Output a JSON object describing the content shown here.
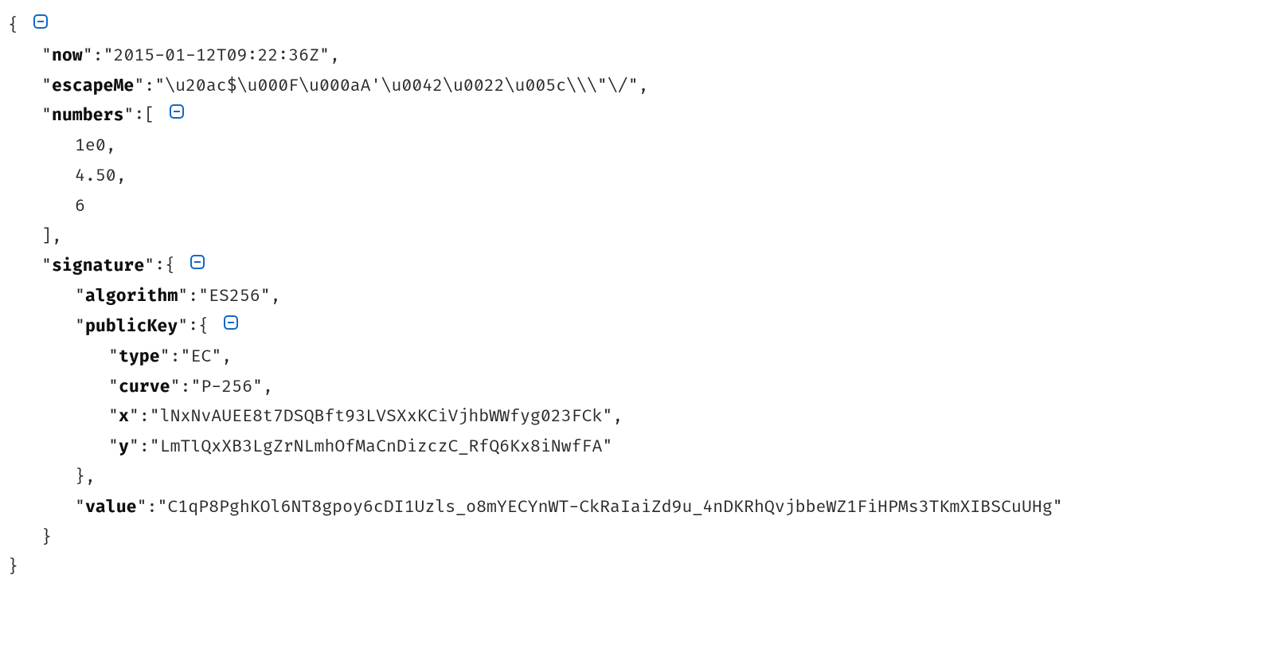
{
  "json": {
    "now": "2015-01-12T09:22:36Z",
    "escapeMe": "\\u20ac$\\u000F\\u000aA'\\u0042\\u0022\\u005c\\\\\\\"\\/",
    "numbers": [
      "1e0",
      "4.50",
      "6"
    ],
    "signature": {
      "algorithm": "ES256",
      "publicKey": {
        "type": "EC",
        "curve": "P-256",
        "x": "lNxNvAUEE8t7DSQBft93LVSXxKCiVjhbWWfyg023FCk",
        "y": "LmTlQxXB3LgZrNLmhOfMaCnDizczC_RfQ6Kx8iNwfFA"
      },
      "value": "C1qP8PghKOl6NT8gpoy6cDI1Uzls_o8mYECYnWT-CkRaIaiZd9u_4nDKRhQvjbbeWZ1FiHPMs3TKmXIBSCuUHg"
    }
  },
  "keys": {
    "now": "now",
    "escapeMe": "escapeMe",
    "numbers": "numbers",
    "signature": "signature",
    "algorithm": "algorithm",
    "publicKey": "publicKey",
    "type": "type",
    "curve": "curve",
    "x": "x",
    "y": "y",
    "value": "value"
  },
  "punct": {
    "open_brace": "{",
    "close_brace": "}",
    "open_bracket": "[",
    "close_bracket": "]",
    "colon": ":",
    "comma": ",",
    "quote": "\"",
    "close_brace_comma": "},",
    "close_bracket_comma": "],"
  }
}
